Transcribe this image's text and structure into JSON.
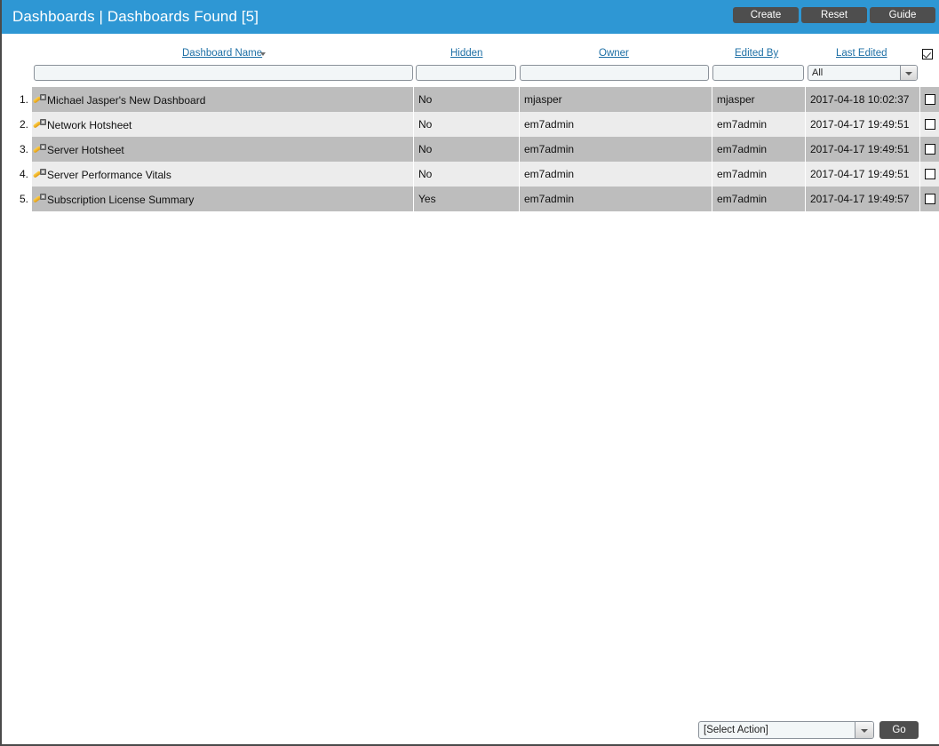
{
  "titlebar": {
    "title": "Dashboards | Dashboards Found [5]",
    "buttons": {
      "create": "Create",
      "reset": "Reset",
      "guide": "Guide"
    },
    "background_color": "#2e97d4",
    "button_color": "#4e4e4e"
  },
  "columns": [
    {
      "key": "name",
      "label": "Dashboard Name",
      "sorted": true,
      "sort_direction": "desc"
    },
    {
      "key": "hidden",
      "label": "Hidden",
      "sorted": false
    },
    {
      "key": "owner",
      "label": "Owner",
      "sorted": false
    },
    {
      "key": "editor",
      "label": "Edited By",
      "sorted": false
    },
    {
      "key": "date",
      "label": "Last Edited",
      "sorted": false
    }
  ],
  "select_all": {
    "checked": true
  },
  "filters": {
    "name": {
      "value": "",
      "placeholder": ""
    },
    "hidden": {
      "value": "",
      "placeholder": ""
    },
    "owner": {
      "value": "",
      "placeholder": ""
    },
    "editor": {
      "value": "",
      "placeholder": ""
    },
    "date": {
      "selected": "All",
      "options": [
        "All"
      ]
    }
  },
  "rows": [
    {
      "num": "1.",
      "name": "Michael Jasper's New Dashboard",
      "hidden": "No",
      "owner": "mjasper",
      "editor": "mjasper",
      "date": "2017-04-18 10:02:37",
      "checked": false,
      "icon": "wrench-icon"
    },
    {
      "num": "2.",
      "name": "Network Hotsheet",
      "hidden": "No",
      "owner": "em7admin",
      "editor": "em7admin",
      "date": "2017-04-17 19:49:51",
      "checked": false,
      "icon": "wrench-icon"
    },
    {
      "num": "3.",
      "name": "Server Hotsheet",
      "hidden": "No",
      "owner": "em7admin",
      "editor": "em7admin",
      "date": "2017-04-17 19:49:51",
      "checked": false,
      "icon": "wrench-icon"
    },
    {
      "num": "4.",
      "name": "Server Performance Vitals",
      "hidden": "No",
      "owner": "em7admin",
      "editor": "em7admin",
      "date": "2017-04-17 19:49:51",
      "checked": false,
      "icon": "wrench-icon"
    },
    {
      "num": "5.",
      "name": "Subscription License Summary",
      "hidden": "Yes",
      "owner": "em7admin",
      "editor": "em7admin",
      "date": "2017-04-17 19:49:57",
      "checked": false,
      "icon": "wrench-icon"
    }
  ],
  "actionbar": {
    "select": {
      "selected": "[Select Action]",
      "options": [
        "[Select Action]"
      ]
    },
    "go_label": "Go"
  }
}
